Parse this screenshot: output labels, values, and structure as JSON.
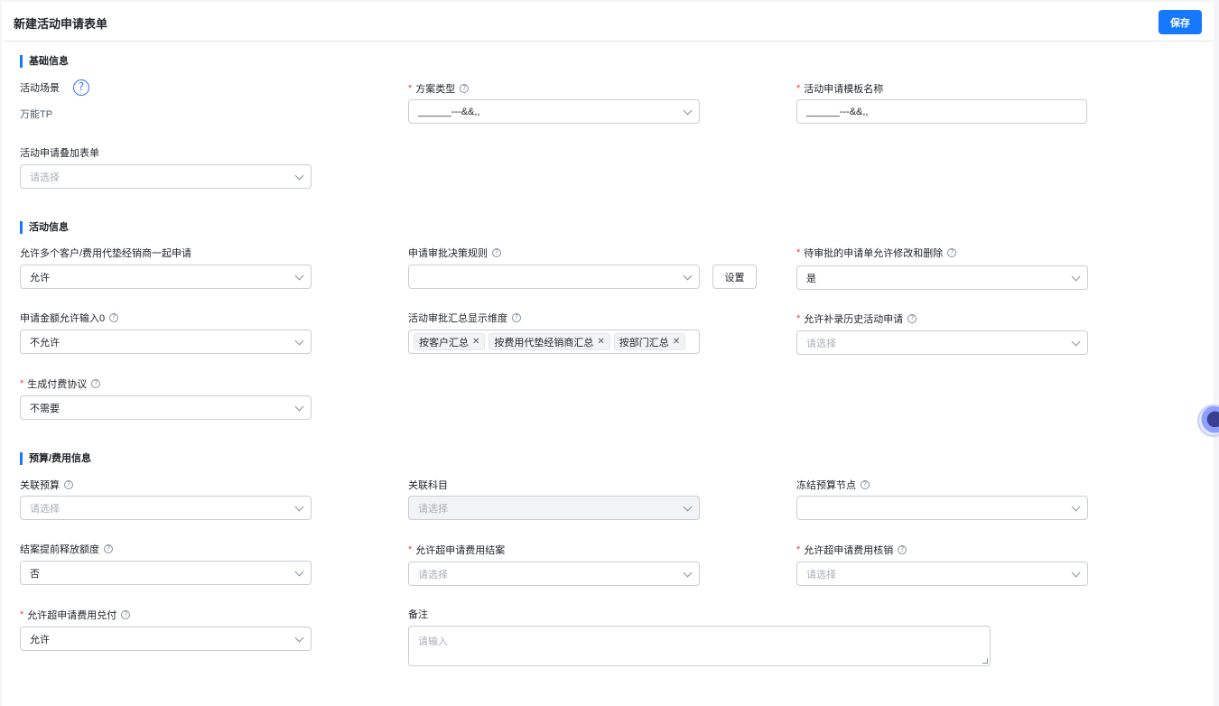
{
  "header": {
    "title": "新建活动申请表单",
    "save_label": "保存"
  },
  "sections": {
    "basic": "基础信息",
    "activity": "活动信息",
    "budget": "预算/费用信息"
  },
  "icons": {
    "help": "question-circle-icon",
    "chevron": "chevron-down-icon",
    "close": "close-icon",
    "assistant": "assistant-icon"
  },
  "colors": {
    "primary": "#1677ff",
    "required": "#f53f3f"
  },
  "fields": {
    "activity_scene": {
      "label": "活动场景",
      "value": "万能TP"
    },
    "plan_type": {
      "label": "方案类型",
      "value": "______---&&,,"
    },
    "template_name": {
      "label": "活动申请模板名称",
      "value": "______---&&,,"
    },
    "overlay_form": {
      "label": "活动申请叠加表单",
      "placeholder": "请选择"
    },
    "multi_customer": {
      "label": "允许多个客户/费用代垫经销商一起申请",
      "value": "允许"
    },
    "approval_rule": {
      "label": "申请审批决策规则",
      "value": "",
      "button": "设置"
    },
    "pending_edit": {
      "label": "待审批的申请单允许修改和删除",
      "value": "是"
    },
    "amount_zero": {
      "label": "申请金额允许输入0",
      "value": "不允许"
    },
    "summary_dims": {
      "label": "活动审批汇总显示维度",
      "tags": [
        "按客户汇总",
        "按费用代垫经销商汇总",
        "按部门汇总"
      ]
    },
    "history_entry": {
      "label": "允许补录历史活动申请",
      "placeholder": "请选择"
    },
    "payment_agreement": {
      "label": "生成付费协议",
      "value": "不需要"
    },
    "linked_budget": {
      "label": "关联预算",
      "placeholder": "请选择"
    },
    "linked_subject": {
      "label": "关联科目",
      "placeholder": "请选择"
    },
    "freeze_node": {
      "label": "冻结预算节点",
      "value": ""
    },
    "release_quota": {
      "label": "结案提前释放额度",
      "value": "否"
    },
    "over_close": {
      "label": "允许超申请费用结案",
      "placeholder": "请选择"
    },
    "over_writeoff": {
      "label": "允许超申请费用核销",
      "placeholder": "请选择"
    },
    "over_payout": {
      "label": "允许超申请费用兑付",
      "value": "允许"
    },
    "remark": {
      "label": "备注",
      "placeholder": "请输入"
    }
  }
}
